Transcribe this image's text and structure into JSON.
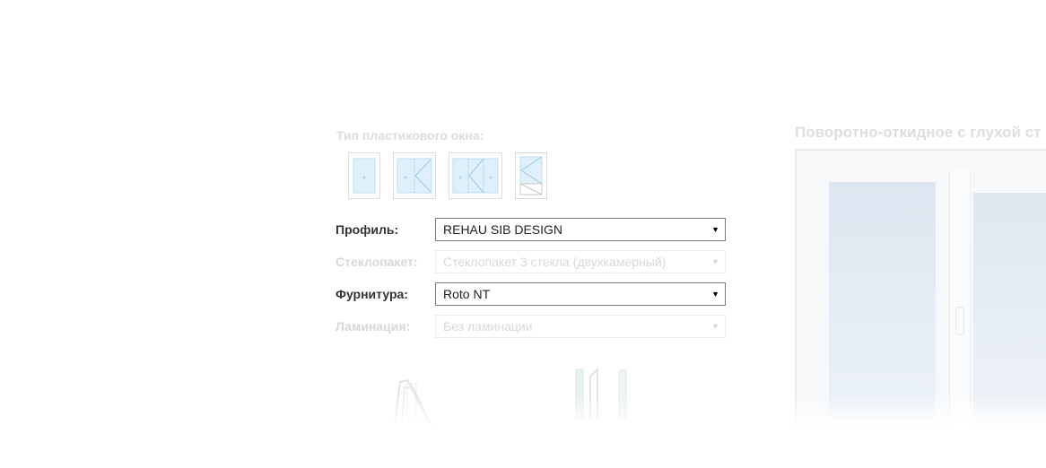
{
  "window_type": {
    "title": "Тип пластикового окна:",
    "options": [
      {
        "icon": "single-sash-window-icon"
      },
      {
        "icon": "double-sash-window-icon"
      },
      {
        "icon": "triple-sash-window-icon"
      },
      {
        "icon": "balcony-door-icon"
      }
    ]
  },
  "form": {
    "profile": {
      "label": "Профиль:",
      "value": "REHAU SIB DESIGN",
      "enabled": true
    },
    "glazing": {
      "label": "Стеклопакет:",
      "value": "Стеклопакет 3 стекла (двухкамерный)",
      "enabled": false
    },
    "hardware": {
      "label": "Фурнитура:",
      "value": "Roto NT",
      "enabled": true
    },
    "lamination": {
      "label": "Ламинация:",
      "value": "Без ламинации",
      "enabled": false
    }
  },
  "preview": {
    "title": "Поворотно-откидное с глухой ст"
  },
  "arrow_glyph": "▼"
}
